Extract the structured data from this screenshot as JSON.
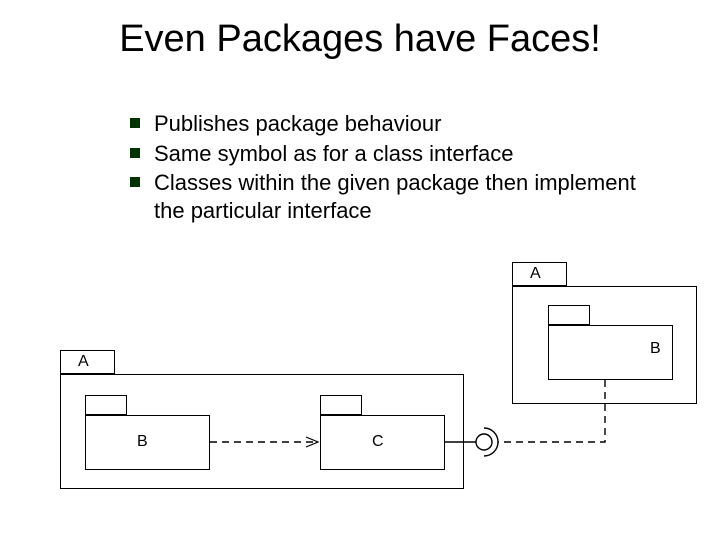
{
  "title": "Even Packages have Faces!",
  "bullets": [
    "Publishes package behaviour",
    "Same symbol as for a class interface",
    "Classes within the given package then implement the particular interface"
  ],
  "labels": {
    "leftOuter": "A",
    "leftInnerLeft": "B",
    "leftInnerRight": "C",
    "rightOuter": "A",
    "rightInner": "B"
  }
}
